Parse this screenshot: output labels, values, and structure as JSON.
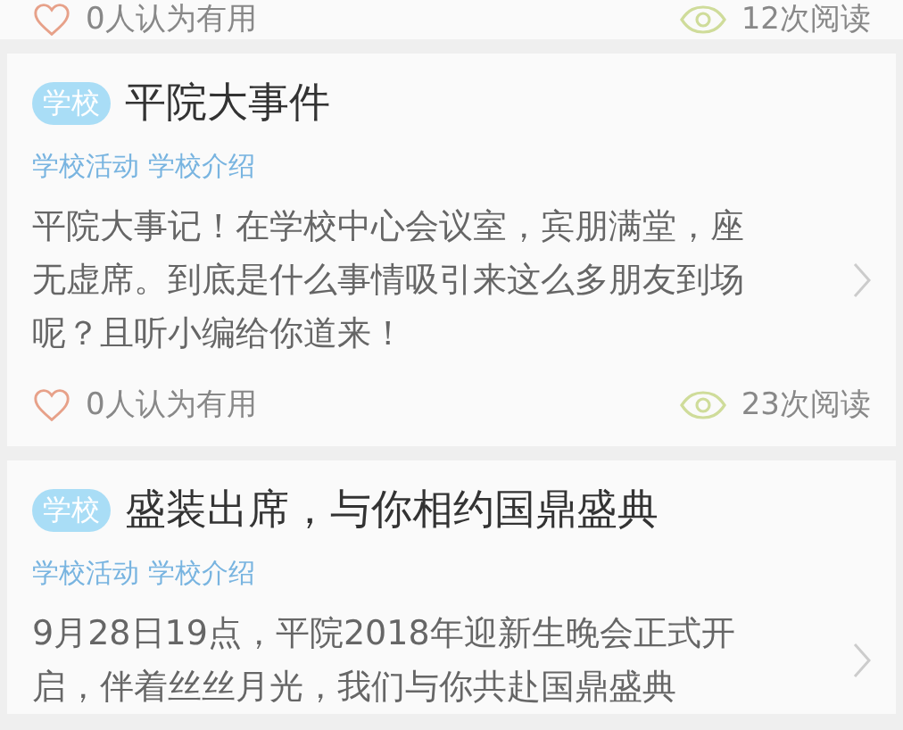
{
  "previous_card_footer": {
    "likes": "0人认为有用",
    "views": "12次阅读"
  },
  "articles": [
    {
      "badge": "学校",
      "title": "平院大事件",
      "tags": "学校活动 学校介绍",
      "summary": "平院大事记！在学校中心会议室，宾朋满堂，座无虚席。到底是什么事情吸引来这么多朋友到场呢？且听小编给你道来！",
      "likes": "0人认为有用",
      "views": "23次阅读"
    },
    {
      "badge": "学校",
      "title": "盛装出席，与你相约国鼎盛典",
      "tags": "学校活动 学校介绍",
      "summary": "9月28日19点，平院2018年迎新生晚会正式开启，伴着丝丝月光，我们与你共赴国鼎盛典"
    }
  ]
}
